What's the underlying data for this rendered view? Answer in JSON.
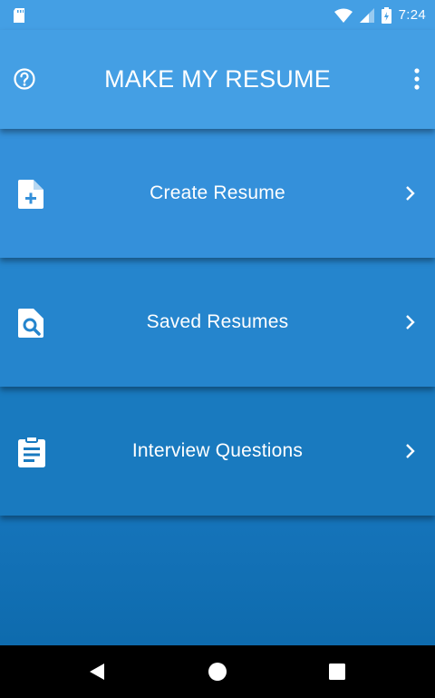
{
  "status_bar": {
    "time": "7:24",
    "icons": [
      "sd-card-icon",
      "wifi-icon",
      "cell-signal-icon",
      "battery-charging-icon"
    ]
  },
  "header": {
    "title": "MAKE MY RESUME",
    "left_icon": "help-icon",
    "right_icon": "more-vert-icon"
  },
  "menu": {
    "items": [
      {
        "label": "Create Resume",
        "icon": "add-document-icon"
      },
      {
        "label": "Saved Resumes",
        "icon": "search-document-icon"
      },
      {
        "label": "Interview Questions",
        "icon": "clipboard-icon"
      }
    ]
  },
  "nav_bar": {
    "buttons": [
      "back",
      "home",
      "recents"
    ]
  },
  "colors": {
    "header": "#449fe4",
    "item_1": "#3490da",
    "item_2": "#2585cd",
    "item_3": "#197abf",
    "background_bottom": "#0b67a8",
    "nav_bar": "#000000"
  }
}
